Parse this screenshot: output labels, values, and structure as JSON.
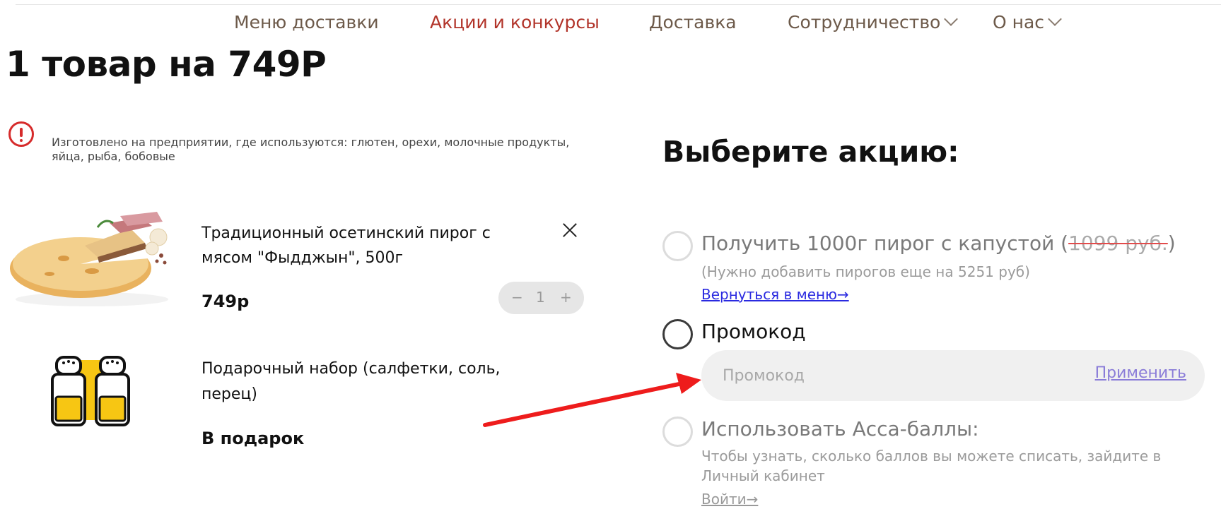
{
  "nav": {
    "items": [
      {
        "label": "Меню доставки",
        "active": false
      },
      {
        "label": "Акции и конкурсы",
        "active": true
      },
      {
        "label": "Доставка",
        "active": false
      },
      {
        "label": "Сотрудничество",
        "active": false,
        "dropdown": true
      },
      {
        "label": "О нас",
        "active": false,
        "dropdown": true
      }
    ]
  },
  "cart": {
    "title": "1 товар на 749Р",
    "allergen_notice": "Изготовлено на предприятии, где используются: глютен, орехи, молочные продукты, яйца, рыба, бобовые",
    "items": [
      {
        "name": "Традиционный осетинский пирог с мясом \"Фыдджын\", 500г",
        "price": "749р",
        "quantity": "1",
        "minus": "−",
        "plus": "+",
        "image_icon": "pie-image"
      },
      {
        "name": "Подарочный набор (салфетки, соль, перец)",
        "price": "В подарок",
        "image_icon": "salt-pepper-icon"
      }
    ]
  },
  "promo": {
    "heading": "Выберите акцию:",
    "options": [
      {
        "title_prefix": "Получить 1000г пирог с капустой (",
        "title_strike": "1099 руб.",
        "title_suffix": ")",
        "note": "(Нужно добавить пирогов еще на 5251 руб)",
        "link": "Вернуться в меню→"
      },
      {
        "title": "Промокод",
        "input_placeholder": "Промокод",
        "apply_label": "Применить"
      },
      {
        "title": "Использовать Асса-баллы:",
        "note": "Чтобы узнать, сколько баллов вы можете списать, зайдите в Личный кабинет",
        "link": "Войти→"
      }
    ]
  },
  "colors": {
    "nav_text": "#6d5a4a",
    "nav_active": "#b2342a",
    "alert_red": "#d62b2b",
    "link_blue": "#2a2ae0",
    "apply_purple": "#8a7cd8",
    "annotation_arrow": "#ee1c1c"
  }
}
